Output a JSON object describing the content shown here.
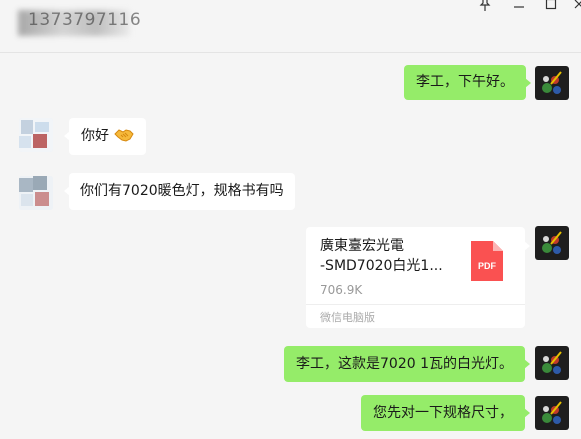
{
  "header": {
    "title": "1373797116",
    "pin_icon": "pin-icon",
    "minimize_icon": "minimize-icon",
    "maximize_icon": "maximize-icon",
    "close_icon": "close-icon"
  },
  "messages": [
    {
      "side": "self",
      "type": "text",
      "text": "李工，下午好。"
    },
    {
      "side": "other",
      "type": "text",
      "text": "你好",
      "emoji": "handshake-emoji"
    },
    {
      "side": "other",
      "type": "text",
      "text": "你们有7020暖色灯，规格书有吗"
    },
    {
      "side": "self",
      "type": "file",
      "file_name_line1": "廣東臺宏光電",
      "file_name_line2": "-SMD7020白光1...",
      "file_size": "706.9K",
      "source": "微信电脑版",
      "file_icon_label": "PDF"
    },
    {
      "side": "self",
      "type": "text",
      "text": "李工，这款是7020 1瓦的白光灯。"
    },
    {
      "side": "self",
      "type": "text",
      "text": "您先对一下规格尺寸，"
    }
  ],
  "colors": {
    "background": "#f5f5f5",
    "self_bubble": "#95ec69",
    "other_bubble": "#ffffff",
    "pdf_red": "#fa5151"
  }
}
